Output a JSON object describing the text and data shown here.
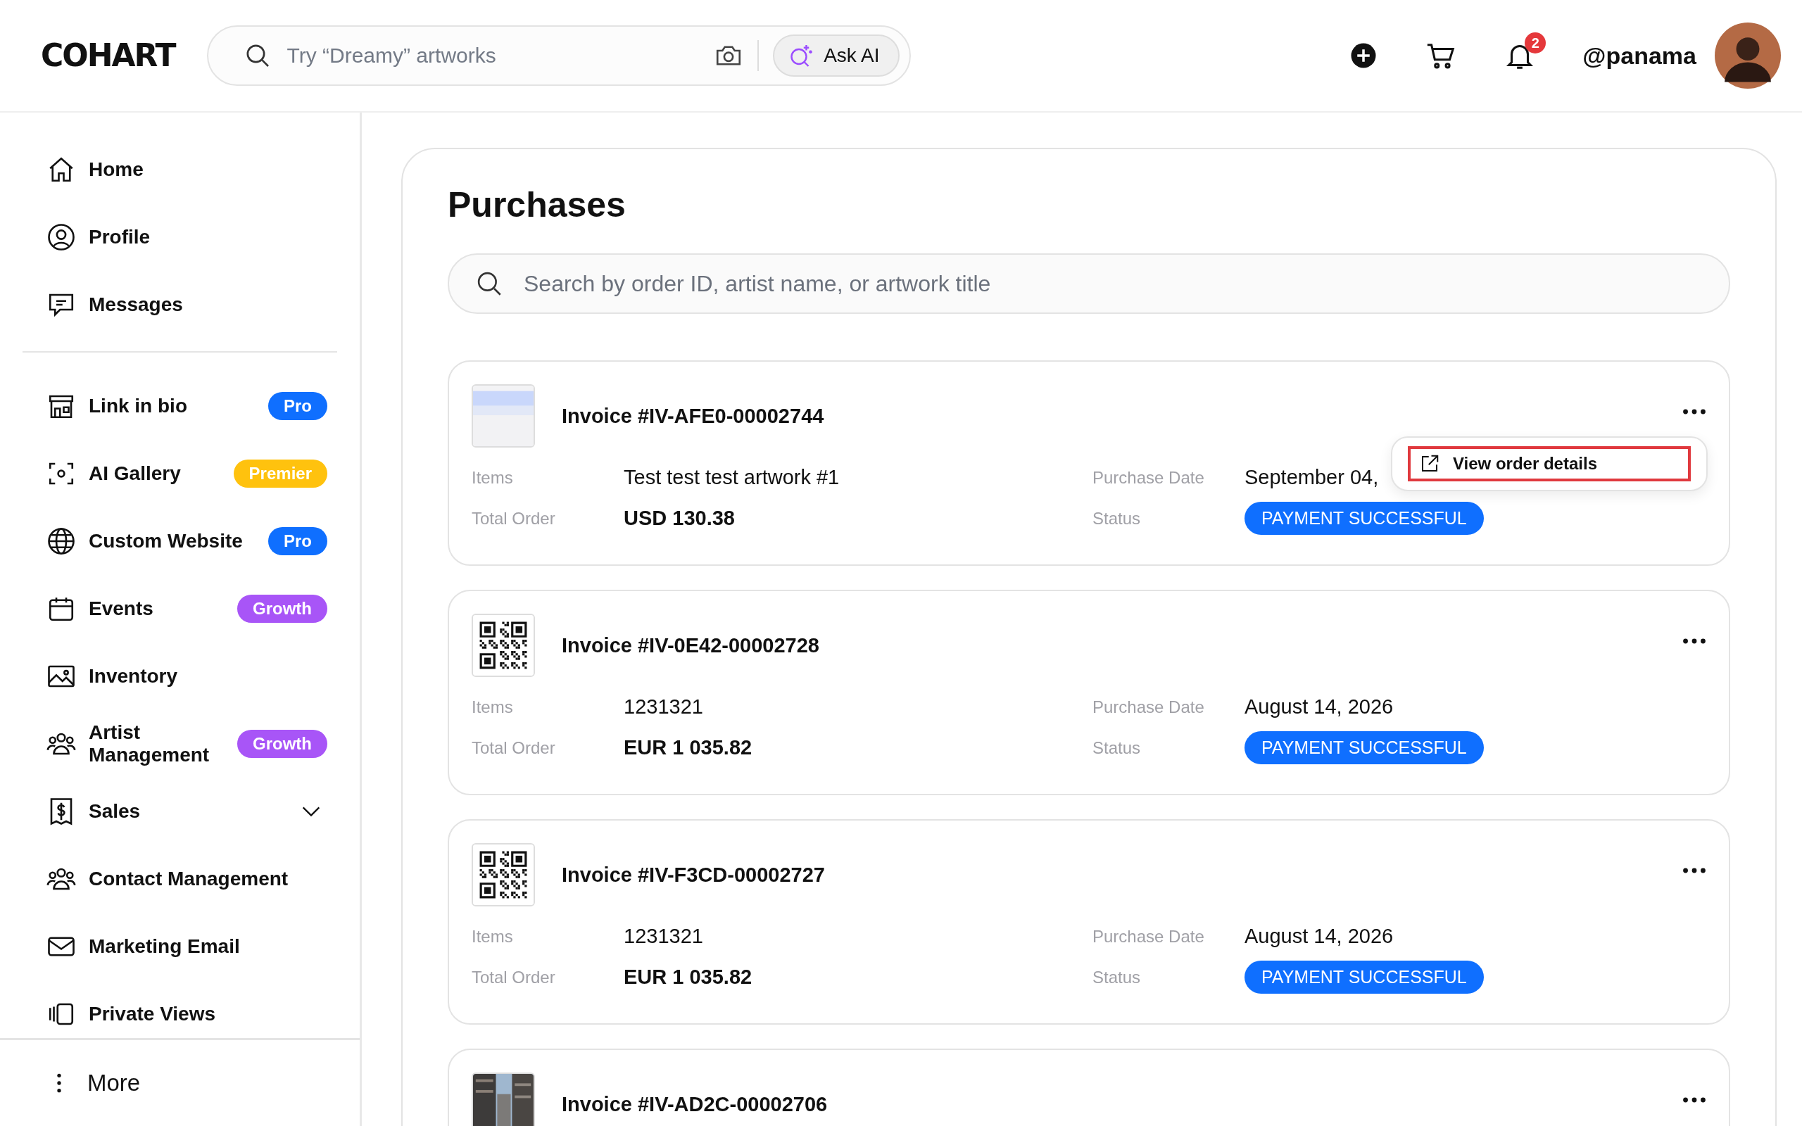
{
  "header": {
    "logo": "COHART",
    "search_placeholder": "Try “Dreamy” artworks",
    "ask_ai": "Ask AI",
    "notification_count": "2",
    "username": "@panama"
  },
  "sidebar": {
    "items": [
      {
        "label": "Home"
      },
      {
        "label": "Profile"
      },
      {
        "label": "Messages",
        "divider_after": true
      },
      {
        "label": "Link in bio",
        "badge": {
          "text": "Pro",
          "color": "#0f6fff"
        }
      },
      {
        "label": "AI Gallery",
        "badge": {
          "text": "Premier",
          "color": "#ffc20e"
        }
      },
      {
        "label": "Custom Website",
        "badge": {
          "text": "Pro",
          "color": "#0f6fff"
        }
      },
      {
        "label": "Events",
        "badge": {
          "text": "Growth",
          "color": "#a855f7"
        }
      },
      {
        "label": "Inventory"
      },
      {
        "label": "Artist Management",
        "badge": {
          "text": "Growth",
          "color": "#a855f7"
        }
      },
      {
        "label": "Sales",
        "expandable": true
      },
      {
        "label": "Contact Management"
      },
      {
        "label": "Marketing Email"
      },
      {
        "label": "Private Views"
      }
    ],
    "more": "More"
  },
  "main": {
    "title": "Purchases",
    "search_placeholder": "Search by order ID, artist name, or artwork title",
    "orders": [
      {
        "invoice": "Invoice #IV-AFE0-00002744",
        "items_label": "Items",
        "items": "Test test test artwork #1",
        "total_label": "Total Order",
        "total": "USD 130.38",
        "date_label": "Purchase Date",
        "date": "September 04,",
        "status_label": "Status",
        "status": "PAYMENT SUCCESSFUL",
        "menu": {
          "item": "View order details",
          "highlighted": true
        }
      },
      {
        "invoice": "Invoice #IV-0E42-00002728",
        "items_label": "Items",
        "items": "1231321",
        "total_label": "Total Order",
        "total": "EUR 1 035.82",
        "date_label": "Purchase Date",
        "date": "August 14, 2026",
        "status_label": "Status",
        "status": "PAYMENT SUCCESSFUL"
      },
      {
        "invoice": "Invoice #IV-F3CD-00002727",
        "items_label": "Items",
        "items": "1231321",
        "total_label": "Total Order",
        "total": "EUR 1 035.82",
        "date_label": "Purchase Date",
        "date": "August 14, 2026",
        "status_label": "Status",
        "status": "PAYMENT SUCCESSFUL"
      },
      {
        "invoice": "Invoice #IV-AD2C-00002706"
      }
    ]
  }
}
